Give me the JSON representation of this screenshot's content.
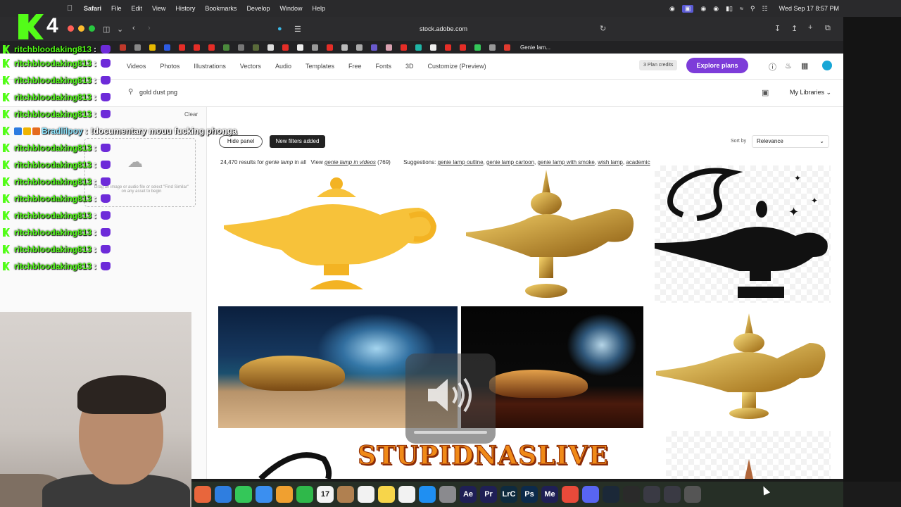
{
  "menubar": {
    "app_name": "Safari",
    "items": [
      "File",
      "Edit",
      "View",
      "History",
      "Bookmarks",
      "Develop",
      "Window",
      "Help"
    ],
    "clock": "Wed Sep 17  8:57 PM"
  },
  "browser": {
    "address": "stock.adobe.com",
    "last_tab_label": "Genie lam..."
  },
  "stock": {
    "nav": [
      "Videos",
      "Photos",
      "Illustrations",
      "Vectors",
      "Audio",
      "Templates",
      "Free",
      "Fonts",
      "3D",
      "Customize (Preview)"
    ],
    "credits": "3 Plan credits",
    "explore_label": "Explore plans",
    "search_query": "gold dust png",
    "libraries_label": "My Libraries",
    "clear_label": "Clear",
    "dropzone_text": "Drag an image or audio file or select \"Find Similar\" on any asset to begin",
    "hide_panel_label": "Hide panel",
    "new_filters_label": "New filters added",
    "sort_label": "Sort by",
    "sort_value": "Relevance",
    "results_count": "24,470 results for",
    "results_term": "genie lamp",
    "results_scope": "in all",
    "view_prefix": "View",
    "view_link": "genie lamp in videos",
    "view_count": "(769)",
    "suggestions_label": "Suggestions:",
    "suggestions": [
      "genie lamp outline",
      "genie lamp cartoon",
      "genie lamp with smoke",
      "wish lamp",
      "academic"
    ]
  },
  "chat": {
    "messages": [
      {
        "user": "ritchbloodaking813",
        "text": ""
      },
      {
        "user": "ritchbloodaking813",
        "text": ""
      },
      {
        "user": "ritchbloodaking813",
        "text": ""
      },
      {
        "user": "Bradlilpoy",
        "text": "!documentary mouu fucking phonga"
      },
      {
        "user": "ritchbloodaking813",
        "text": ""
      },
      {
        "user": "ritchbloodaking813",
        "text": ""
      },
      {
        "user": "ritchbloodaking813",
        "text": ""
      },
      {
        "user": "ritchbloodaking813",
        "text": ""
      },
      {
        "user": "ritchbloodaking813",
        "text": ""
      },
      {
        "user": "ritchbloodaking813",
        "text": ""
      },
      {
        "user": "ritchbloodaking813",
        "text": ""
      },
      {
        "user": "ritchbloodaking813",
        "text": ""
      },
      {
        "user": "ritchbloodaking813",
        "text": ""
      },
      {
        "user": "ritchbloodaking813",
        "text": ""
      }
    ]
  },
  "overlay": {
    "kick_badge_number": "4",
    "wordmark": "STUPIDNASLIVE"
  },
  "dock": {
    "apps": [
      {
        "icon": "launchpad-icon",
        "label": "",
        "color": "#e8663c"
      },
      {
        "icon": "safari-icon",
        "label": "",
        "color": "#2f7ee0"
      },
      {
        "icon": "messages-icon",
        "label": "",
        "color": "#34c759"
      },
      {
        "icon": "mail-icon",
        "label": "",
        "color": "#3b8ff0"
      },
      {
        "icon": "photos-icon",
        "label": "",
        "color": "#f0a030"
      },
      {
        "icon": "facetime-icon",
        "label": "",
        "color": "#2fb84a"
      },
      {
        "icon": "calendar-icon",
        "label": "17",
        "color": "#f4f4f4"
      },
      {
        "icon": "finder-folder-icon",
        "label": "",
        "color": "#b08050"
      },
      {
        "icon": "reminders-icon",
        "label": "",
        "color": "#f2f2f2"
      },
      {
        "icon": "notes-icon",
        "label": "",
        "color": "#f7d54a"
      },
      {
        "icon": "freeform-icon",
        "label": "",
        "color": "#f2f2f2"
      },
      {
        "icon": "app-store-icon",
        "label": "",
        "color": "#1f8ff2"
      },
      {
        "icon": "settings-icon",
        "label": "",
        "color": "#8a8a8e"
      },
      {
        "icon": "after-effects-icon",
        "label": "Ae",
        "color": "#1f1f55"
      },
      {
        "icon": "premiere-icon",
        "label": "Pr",
        "color": "#1f1f55"
      },
      {
        "icon": "lightroom-classic-icon",
        "label": "LrC",
        "color": "#0e2a3e"
      },
      {
        "icon": "photoshop-icon",
        "label": "Ps",
        "color": "#0c2a4b"
      },
      {
        "icon": "media-encoder-icon",
        "label": "Me",
        "color": "#1f1f55"
      },
      {
        "icon": "chrome-icon",
        "label": "",
        "color": "#e84a3a"
      },
      {
        "icon": "discord-icon",
        "label": "",
        "color": "#5865f2"
      },
      {
        "icon": "steam-icon",
        "label": "",
        "color": "#1b2838"
      },
      {
        "icon": "obs-icon",
        "label": "",
        "color": "#2a2a2a"
      },
      {
        "icon": "downloads-icon",
        "label": "",
        "color": "#3a3a44"
      },
      {
        "icon": "grid-icon",
        "label": "",
        "color": "#3a3a44"
      },
      {
        "icon": "trash-icon",
        "label": "",
        "color": "#555"
      }
    ]
  }
}
